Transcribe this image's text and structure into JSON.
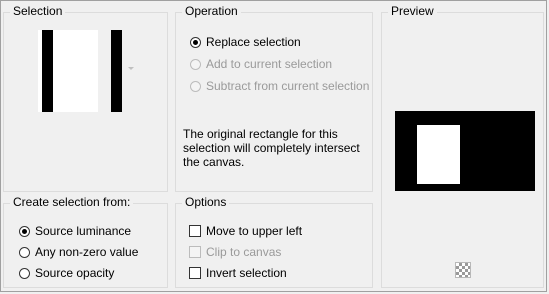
{
  "selection": {
    "title": "Selection"
  },
  "operation": {
    "title": "Operation",
    "options": [
      {
        "label": "Replace selection",
        "checked": true,
        "disabled": false
      },
      {
        "label": "Add to current selection",
        "checked": false,
        "disabled": true
      },
      {
        "label": "Subtract from current selection",
        "checked": false,
        "disabled": true
      }
    ],
    "info_line1": "The original rectangle for this",
    "info_line2": "selection will completely intersect",
    "info_line3": "the canvas."
  },
  "preview": {
    "title": "Preview",
    "transparency_icon": "checkerboard-icon"
  },
  "create_from": {
    "title": "Create selection from:",
    "options": [
      {
        "label": "Source luminance",
        "checked": true
      },
      {
        "label": "Any non-zero value",
        "checked": false
      },
      {
        "label": "Source opacity",
        "checked": false
      }
    ]
  },
  "options": {
    "title": "Options",
    "items": [
      {
        "label": "Move to upper left",
        "checked": false,
        "disabled": false
      },
      {
        "label": "Clip to canvas",
        "checked": false,
        "disabled": true
      },
      {
        "label": "Invert selection",
        "checked": false,
        "disabled": false
      }
    ]
  },
  "colors": {
    "canvas_black": "#000000",
    "canvas_white": "#ffffff"
  }
}
